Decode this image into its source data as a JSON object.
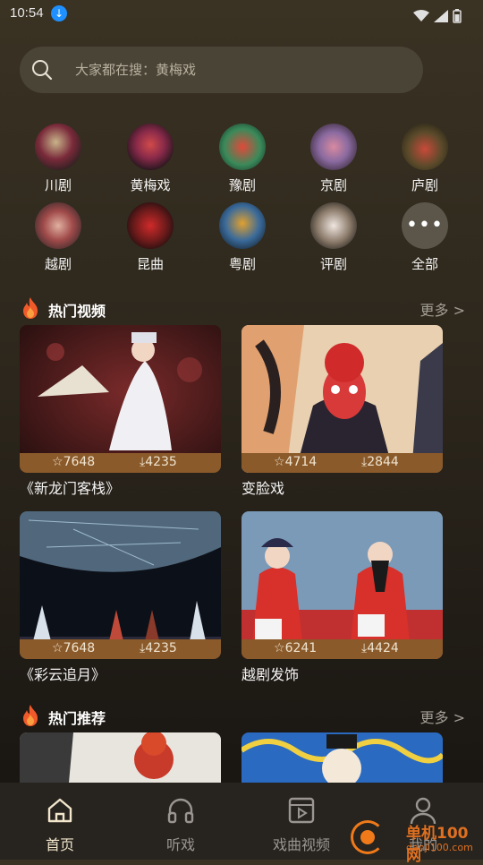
{
  "status": {
    "time": "10:54"
  },
  "search": {
    "placeholder": "大家都在搜：黄梅戏"
  },
  "categories": [
    {
      "label": "川剧"
    },
    {
      "label": "黄梅戏"
    },
    {
      "label": "豫剧"
    },
    {
      "label": "京剧"
    },
    {
      "label": "庐剧"
    },
    {
      "label": "越剧"
    },
    {
      "label": "昆曲"
    },
    {
      "label": "粤剧"
    },
    {
      "label": "评剧"
    },
    {
      "label": "全部"
    }
  ],
  "hot_videos": {
    "title": "热门视频",
    "more": "更多",
    "items": [
      {
        "title": "《新龙门客栈》",
        "stars": "7648",
        "downloads": "4235"
      },
      {
        "title": "变脸戏",
        "stars": "4714",
        "downloads": "2844"
      },
      {
        "title": "《彩云追月》",
        "stars": "7648",
        "downloads": "4235"
      },
      {
        "title": "越剧发饰",
        "stars": "6241",
        "downloads": "4424"
      }
    ]
  },
  "hot_recommend": {
    "title": "热门推荐",
    "more": "更多"
  },
  "nav": [
    {
      "label": "首页"
    },
    {
      "label": "听戏"
    },
    {
      "label": "戏曲视频"
    },
    {
      "label": "我的"
    }
  ],
  "watermark": {
    "name": "单机100网",
    "url": "danji100.com"
  },
  "colors": {
    "accent": "#8a5a2a",
    "nav_active": "#f2e6cc",
    "fire": "#f05a2a"
  }
}
